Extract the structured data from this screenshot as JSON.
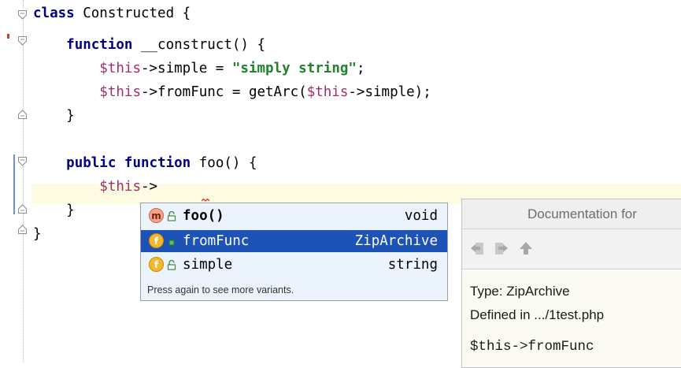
{
  "editor": {
    "lines": [
      {
        "parts": [
          {
            "t": "class",
            "c": "kw"
          },
          {
            "t": " Constructed {",
            "c": ""
          }
        ]
      },
      {
        "parts": [
          {
            "t": "    ",
            "c": ""
          },
          {
            "t": "function",
            "c": "kw"
          },
          {
            "t": " __construct() {",
            "c": ""
          }
        ]
      },
      {
        "parts": [
          {
            "t": "        ",
            "c": ""
          },
          {
            "t": "$this",
            "c": "var"
          },
          {
            "t": "->simple = ",
            "c": ""
          },
          {
            "t": "\"simply string\"",
            "c": "str"
          },
          {
            "t": ";",
            "c": ""
          }
        ]
      },
      {
        "parts": [
          {
            "t": "        ",
            "c": ""
          },
          {
            "t": "$this",
            "c": "var"
          },
          {
            "t": "->fromFunc = getArc(",
            "c": ""
          },
          {
            "t": "$this",
            "c": "var"
          },
          {
            "t": "->simple);",
            "c": ""
          }
        ]
      },
      {
        "parts": [
          {
            "t": "    }",
            "c": ""
          }
        ]
      },
      {
        "parts": []
      },
      {
        "parts": [
          {
            "t": "    ",
            "c": ""
          },
          {
            "t": "public",
            "c": "kw"
          },
          {
            "t": " ",
            "c": ""
          },
          {
            "t": "function",
            "c": "kw"
          },
          {
            "t": " foo() {",
            "c": ""
          }
        ]
      },
      {
        "parts": [
          {
            "t": "        ",
            "c": ""
          },
          {
            "t": "$this",
            "c": "var"
          },
          {
            "t": "->",
            "c": ""
          }
        ]
      },
      {
        "parts": [
          {
            "t": "    }",
            "c": ""
          }
        ]
      },
      {
        "parts": [
          {
            "t": "}",
            "c": ""
          }
        ]
      }
    ]
  },
  "completion": {
    "items": [
      {
        "icon": "method-icon",
        "letter": "m",
        "name": "foo()",
        "type": "void",
        "selected": false
      },
      {
        "icon": "field-icon",
        "letter": "f",
        "name": "fromFunc",
        "type": "ZipArchive",
        "selected": true
      },
      {
        "icon": "field-icon",
        "letter": "f",
        "name": "simple",
        "type": "string",
        "selected": false
      }
    ],
    "hint": "Press again to see more variants."
  },
  "documentation": {
    "title": "Documentation for",
    "type_line": "Type: ZipArchive",
    "defined_line": "Defined in .../1test.php",
    "signature": "$this->fromFunc"
  }
}
